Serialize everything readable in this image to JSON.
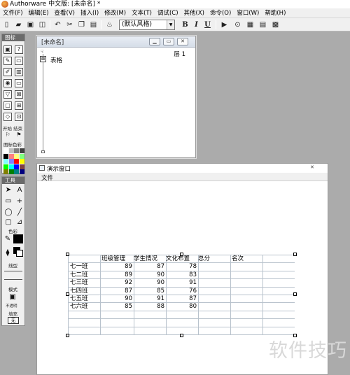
{
  "app": {
    "title": "Authorware 中文版: [未命名] *"
  },
  "menubar": [
    "文件(F)",
    "编辑(E)",
    "查看(V)",
    "插入(I)",
    "修改(M)",
    "文本(T)",
    "调试(C)",
    "其他(X)",
    "命令(O)",
    "窗口(W)",
    "帮助(H)"
  ],
  "toolbar": {
    "style_select": "(默认风格)",
    "bold": "B",
    "italic": "I",
    "underline": "U"
  },
  "icon_palette": {
    "title": "图标",
    "start_stop_label": "开始 结束",
    "color_label": "图标色彩",
    "swatches": [
      "#ffffff",
      "#c0c0c0",
      "#808080",
      "#404040",
      "#000000",
      "#ff8080",
      "#ffff80",
      "#80ff80",
      "#80ffff",
      "#8080ff",
      "#ff0000",
      "#ffff00",
      "#00ff00",
      "#00ffff",
      "#0000ff",
      "#804040",
      "#808000",
      "#008000",
      "#008080",
      "#000080"
    ]
  },
  "tools_palette": {
    "title": "工具",
    "color_label": "色彩",
    "line_label": "线型",
    "mode_label": "模式",
    "mode_value": "不透明",
    "fill_label": "填充",
    "fill_value": "无"
  },
  "flow_window": {
    "title": "[未命名]",
    "level": "层 1",
    "icon_label": "表格"
  },
  "presentation_window": {
    "title": "演示窗口",
    "menu": "文件"
  },
  "table": {
    "headers": [
      "班级管理",
      "学生情况",
      "文化布置",
      "总分",
      "名次"
    ],
    "rows": [
      {
        "class": "七一班",
        "values": [
          "89",
          "87",
          "78"
        ]
      },
      {
        "class": "七二班",
        "values": [
          "89",
          "90",
          "83"
        ]
      },
      {
        "class": "七三班",
        "values": [
          "92",
          "90",
          "91"
        ]
      },
      {
        "class": "七四班",
        "values": [
          "87",
          "85",
          "76"
        ]
      },
      {
        "class": "七五班",
        "values": [
          "90",
          "91",
          "87"
        ]
      },
      {
        "class": "七六班",
        "values": [
          "85",
          "88",
          "80"
        ]
      }
    ]
  },
  "watermark": "软件技巧"
}
